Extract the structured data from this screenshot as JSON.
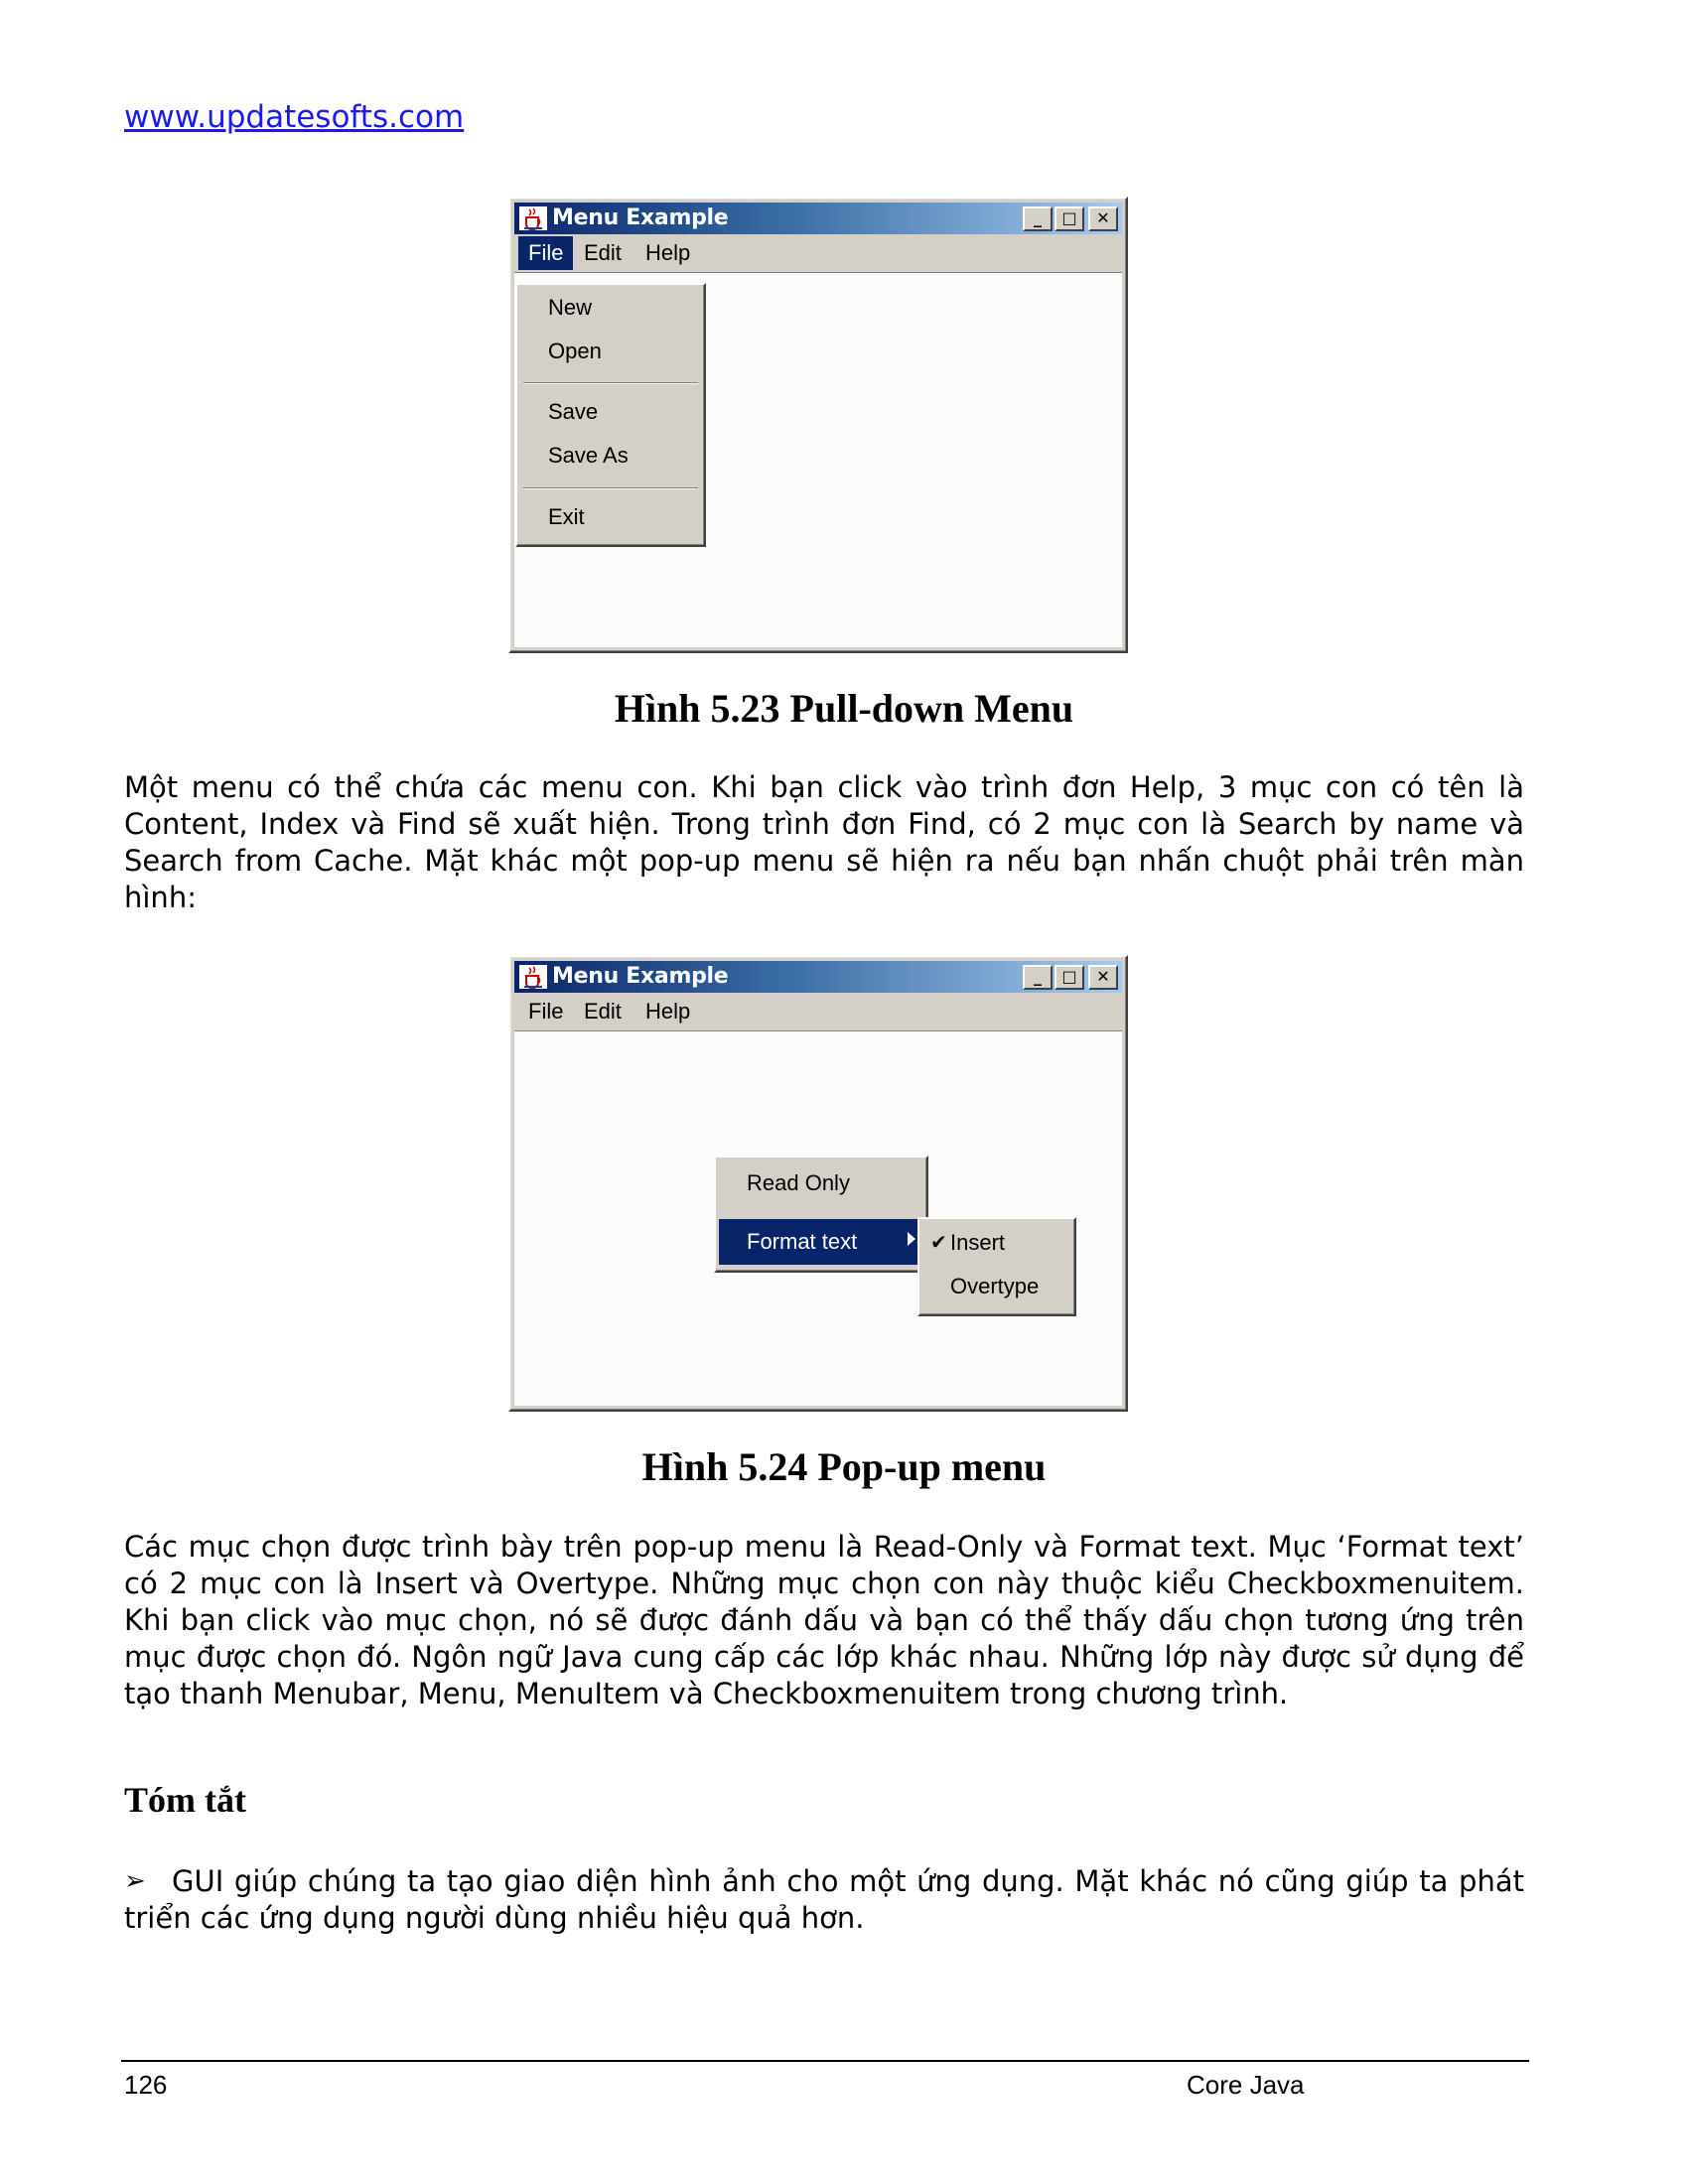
{
  "header": {
    "site_link": "www.updatesofts.com"
  },
  "figure1": {
    "window_title": "Menu Example",
    "menubar": [
      "File",
      "Edit",
      "Help"
    ],
    "file_menu": {
      "new": "New",
      "open": "Open",
      "save": "Save",
      "save_as": "Save As",
      "exit": "Exit"
    },
    "caption": "Hình 5.23 Pull-down Menu"
  },
  "para1": "Một menu có thể chứa các menu con. Khi bạn click vào trình đơn Help, 3 mục con có tên là Content, Index và Find sẽ xuất hiện. Trong trình đơn Find, có 2 mục con là Search by name và Search from Cache. Mặt khác một pop-up menu sẽ hiện ra nếu bạn nhấn chuột phải trên màn hình:",
  "figure2": {
    "window_title": "Menu Example",
    "menubar": [
      "File",
      "Edit",
      "Help"
    ],
    "popup": {
      "read_only": "Read Only",
      "format_text": "Format text"
    },
    "submenu": {
      "insert": "Insert",
      "overtype": "Overtype",
      "check_mark": "✔"
    },
    "caption": "Hình 5.24 Pop-up menu"
  },
  "para2": "Các mục chọn được trình bày trên pop-up menu là Read-Only và Format text. Mục ‘Format text’ có 2 mục con là Insert và Overtype. Những mục chọn con này thuộc kiểu Checkboxmenuitem. Khi bạn click vào mục chọn, nó sẽ được đánh dấu và bạn có thể thấy dấu chọn tương ứng trên mục được chọn đó. Ngôn ngữ Java cung cấp các lớp khác nhau. Những lớp này được sử dụng để tạo thanh Menubar, Menu, MenuItem và Checkboxmenuitem trong chương trình.",
  "summary": {
    "heading": "Tóm tắt",
    "bullet_glyph": "➢",
    "bullets": [
      "GUI giúp chúng ta tạo giao diện hình ảnh cho một ứng dụng. Mặt khác nó cũng giúp ta phát triển các ứng dụng người dùng nhiều hiệu quả hơn."
    ]
  },
  "footer": {
    "page_number": "126",
    "book_title": "Core Java"
  },
  "caption_buttons": {
    "minimize": "_",
    "maximize": "□",
    "close": "✕"
  }
}
